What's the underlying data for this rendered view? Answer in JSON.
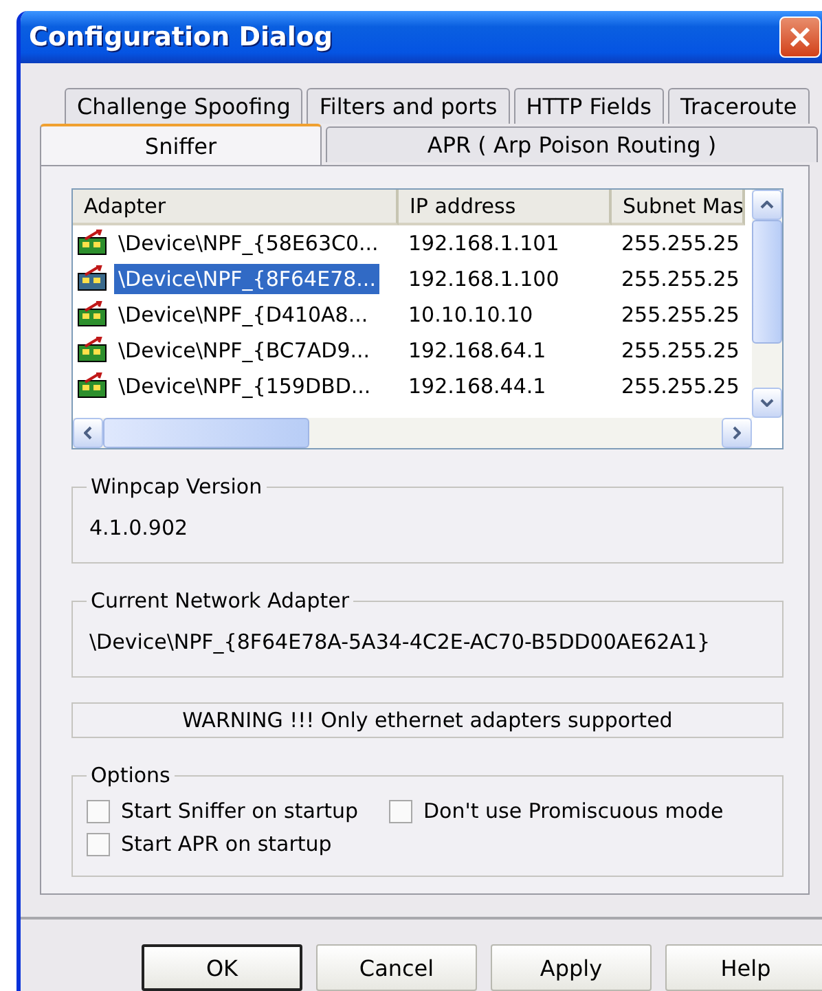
{
  "window": {
    "title": "Configuration Dialog"
  },
  "tab_rows": [
    [
      {
        "label": "Challenge Spoofing",
        "selected": false
      },
      {
        "label": "Filters and ports",
        "selected": false
      },
      {
        "label": "HTTP Fields",
        "selected": false
      },
      {
        "label": "Traceroute",
        "selected": false
      }
    ],
    [
      {
        "label": "Sniffer",
        "selected": true
      },
      {
        "label": "APR ( Arp Poison Routing )",
        "selected": false
      }
    ]
  ],
  "adapter_list": {
    "columns": [
      "Adapter",
      "IP address",
      "Subnet Mas"
    ],
    "rows": [
      {
        "cells": [
          "\\Device\\NPF_{58E63C0...",
          "192.168.1.101",
          "255.255.25"
        ],
        "selected": false
      },
      {
        "cells": [
          "\\Device\\NPF_{8F64E78...",
          "192.168.1.100",
          "255.255.25"
        ],
        "selected": true
      },
      {
        "cells": [
          "\\Device\\NPF_{D410A8...",
          "10.10.10.10",
          "255.255.25"
        ],
        "selected": false
      },
      {
        "cells": [
          "\\Device\\NPF_{BC7AD9...",
          "192.168.64.1",
          "255.255.25"
        ],
        "selected": false
      },
      {
        "cells": [
          "\\Device\\NPF_{159DBD...",
          "192.168.44.1",
          "255.255.25"
        ],
        "selected": false
      }
    ]
  },
  "winpcap_version": {
    "label": "Winpcap Version",
    "value": "4.1.0.902"
  },
  "current_adapter": {
    "label": "Current Network Adapter",
    "value": "\\Device\\NPF_{8F64E78A-5A34-4C2E-AC70-B5DD00AE62A1}"
  },
  "warning": "WARNING !!! Only ethernet adapters supported",
  "options": {
    "label": "Options",
    "items": [
      {
        "label": "Start Sniffer on startup",
        "checked": false
      },
      {
        "label": "Don't use Promiscuous mode",
        "checked": false
      },
      {
        "label": "Start APR on startup",
        "checked": false
      }
    ]
  },
  "buttons": [
    {
      "label": "OK",
      "default": true
    },
    {
      "label": "Cancel",
      "default": false
    },
    {
      "label": "Apply",
      "default": false
    },
    {
      "label": "Help",
      "default": false
    }
  ]
}
